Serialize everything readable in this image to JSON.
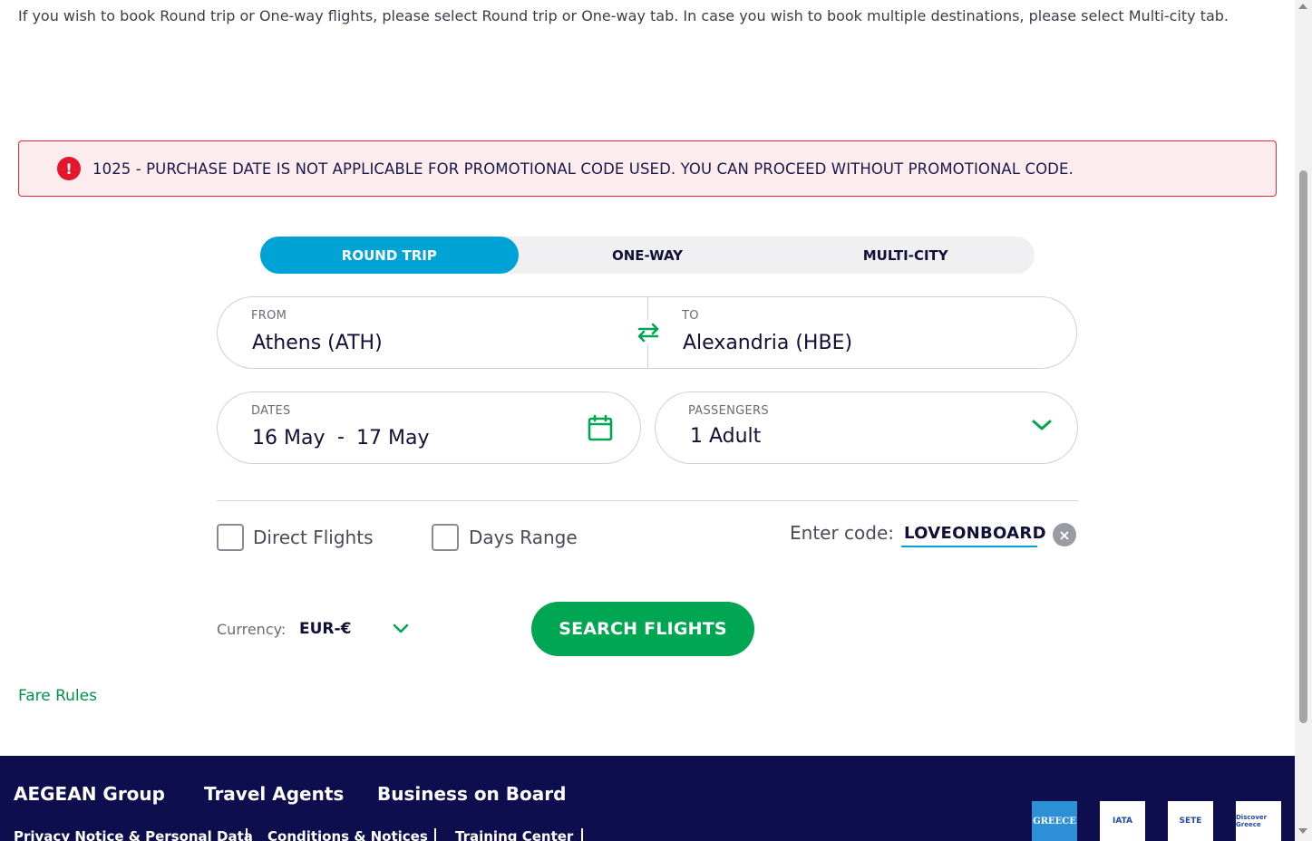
{
  "intro_text": "If you wish to book Round trip or One-way flights, please select Round trip or One-way tab. In case you wish to book multiple destinations, please select Multi-city tab.",
  "alert": {
    "icon": "exclamation-icon",
    "message": "1025 - PURCHASE DATE IS NOT APPLICABLE FOR PROMOTIONAL CODE USED. YOU CAN PROCEED WITHOUT PROMOTIONAL CODE.",
    "color": "#e3162b"
  },
  "tabs": [
    {
      "label": "ROUND TRIP",
      "active": true
    },
    {
      "label": "ONE-WAY",
      "active": false
    },
    {
      "label": "MULTI-CITY",
      "active": false
    }
  ],
  "route": {
    "from_label": "FROM",
    "from_value": "Athens (ATH)",
    "to_label": "TO",
    "to_value": "Alexandria (HBE)",
    "swap_icon": "swap-arrows-icon"
  },
  "dates": {
    "label": "DATES",
    "depart": "16 May",
    "separator": "-",
    "return": "17 May",
    "icon": "calendar-icon"
  },
  "passengers": {
    "label": "PASSENGERS",
    "value": "1 Adult",
    "icon": "chevron-down-icon"
  },
  "options": {
    "direct_flights": {
      "label": "Direct Flights",
      "checked": false
    },
    "days_range": {
      "label": "Days Range",
      "checked": false
    }
  },
  "promo": {
    "label": "Enter code:",
    "value": "LOVEONBOARD",
    "clear_icon": "close-icon"
  },
  "currency": {
    "label": "Currency:",
    "value": "EUR-€"
  },
  "search_button": "SEARCH FLIGHTS",
  "fare_rules": "Fare Rules",
  "footer": {
    "links": [
      "AEGEAN Group",
      "Travel Agents",
      "Business on Board"
    ],
    "sub_links": [
      "Privacy Notice & Personal Data",
      "Conditions & Notices",
      "Training Center"
    ],
    "partners": [
      "GREECE",
      "IATA",
      "SETE",
      "Discover Greece"
    ]
  },
  "colors": {
    "accent_blue": "#00a3d6",
    "accent_green": "#00a651",
    "footer_navy": "#0e0e4e",
    "alert_red": "#e3162b"
  }
}
